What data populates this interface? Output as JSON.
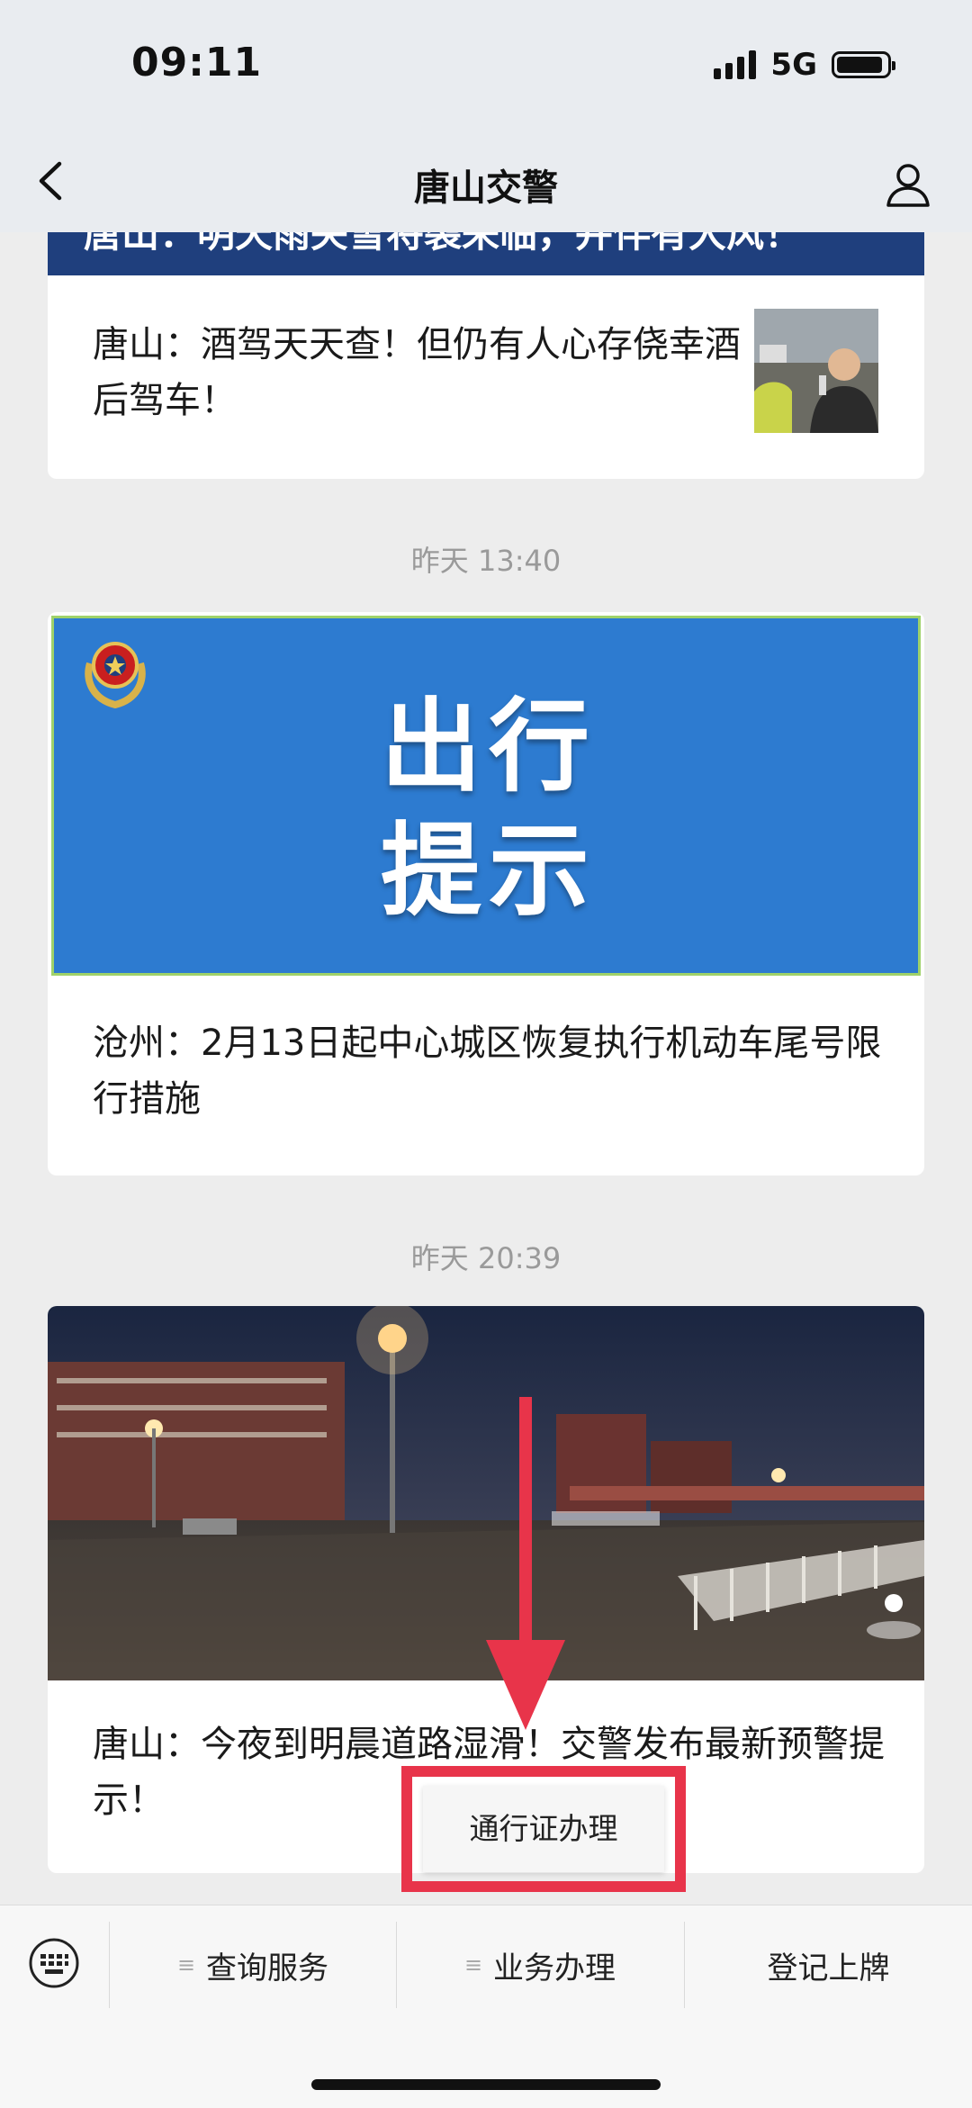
{
  "status": {
    "time": "09:11",
    "network": "5G"
  },
  "nav": {
    "title": "唐山交警"
  },
  "feed": {
    "card1": {
      "banner_text": "唐山：明天雨夹雪将袭来临，并伴有大风！",
      "text": "唐山：酒驾天天查！但仍有人心存侥幸酒后驾车！"
    },
    "ts1": "昨天 13:40",
    "card2": {
      "cover_line1": "出行",
      "cover_line2": "提示",
      "text": "沧州：2月13日起中心城区恢复执行机动车尾号限行措施"
    },
    "ts2": "昨天 20:39",
    "card3": {
      "text": "唐山：今夜到明晨道路湿滑！交警发布最新预警提示！"
    }
  },
  "popup": {
    "item": "通行证办理"
  },
  "menu": {
    "item1": "查询服务",
    "item2": "业务办理",
    "item3": "登记上牌"
  },
  "colors": {
    "annotation": "#e8344a",
    "cover_blue": "#2d7bd0"
  }
}
